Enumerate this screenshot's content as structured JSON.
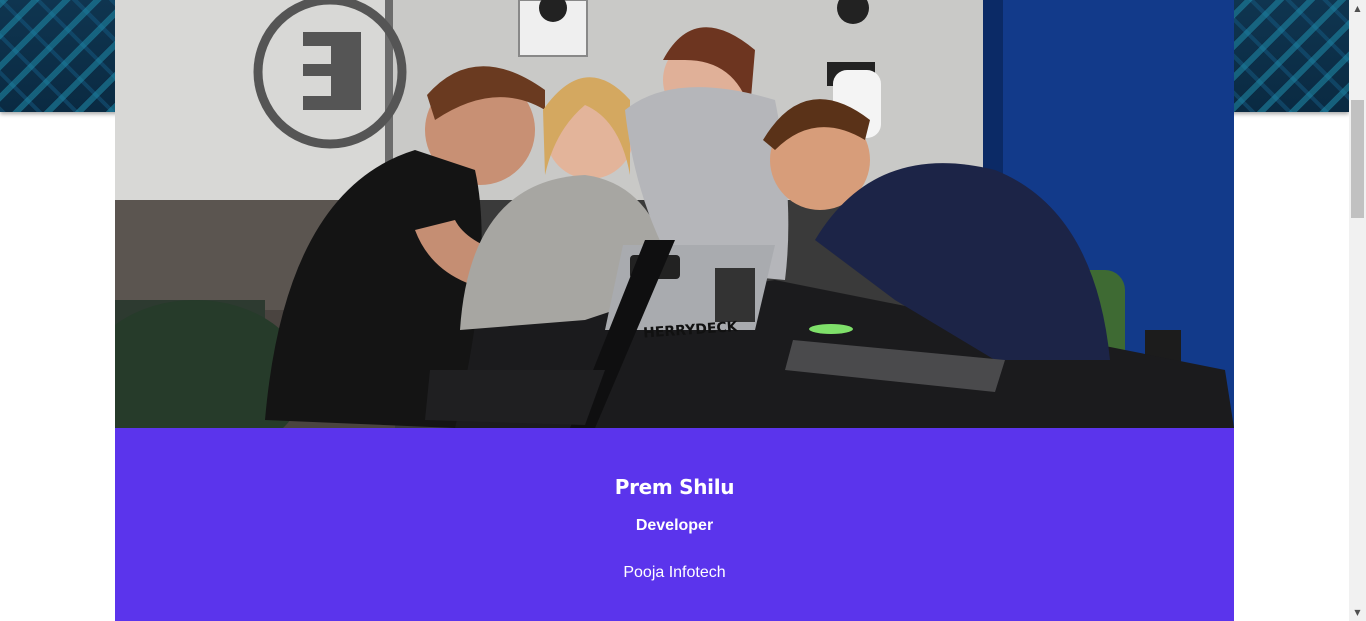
{
  "profile": {
    "name": "Prem Shilu",
    "role": "Developer",
    "company": "Pooja Infotech",
    "photo_alt": "Four colleagues laughing around a laptop at a table"
  },
  "laptop_sticker": "HERRYDECK",
  "colors": {
    "accent": "#5b34ec",
    "banner": "#0f3550",
    "scrollbar_track": "#f1f1f1",
    "scrollbar_thumb": "#c1c1c1"
  },
  "icons": {
    "scroll_up": "scroll-up-arrow-icon",
    "scroll_down": "scroll-down-arrow-icon"
  }
}
